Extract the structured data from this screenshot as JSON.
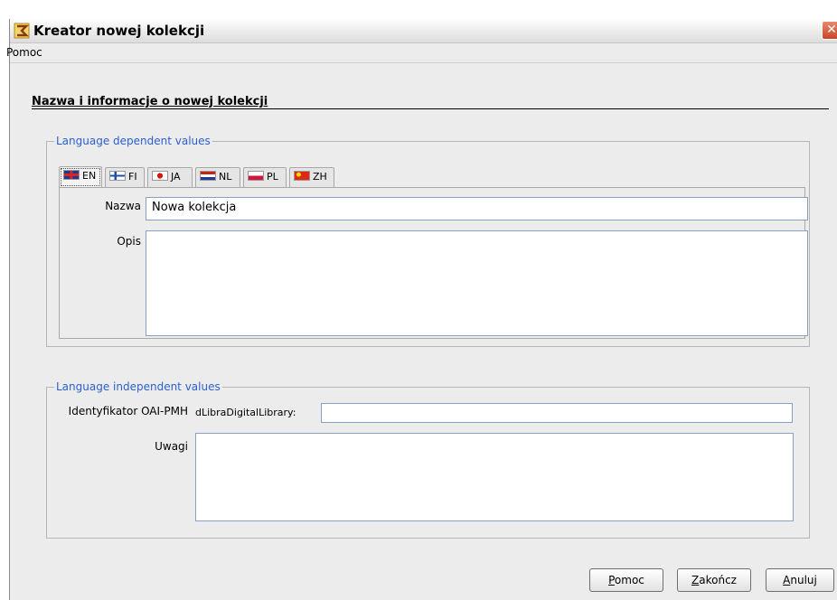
{
  "window": {
    "title": "Kreator nowej kolekcji"
  },
  "menu": {
    "items": [
      "Pomoc"
    ]
  },
  "section": {
    "title": "Nazwa i informacje o nowej kolekcji"
  },
  "lang_dependent": {
    "legend": "Language dependent values",
    "tabs": [
      {
        "code": "EN",
        "flag": "uk-flag"
      },
      {
        "code": "FI",
        "flag": "finland-flag"
      },
      {
        "code": "JA",
        "flag": "japan-flag"
      },
      {
        "code": "NL",
        "flag": "netherlands-flag"
      },
      {
        "code": "PL",
        "flag": "poland-flag"
      },
      {
        "code": "ZH",
        "flag": "china-flag"
      }
    ],
    "active_tab": "EN",
    "name_label": "Nazwa",
    "name_value": "Nowa kolekcja",
    "desc_label": "Opis",
    "desc_value": ""
  },
  "lang_independent": {
    "legend": "Language independent values",
    "oai_label": "Identyfikator OAI-PMH",
    "oai_prefix": "dLibraDigitalLibrary:",
    "oai_value": "",
    "notes_label": "Uwagi",
    "notes_value": ""
  },
  "buttons": {
    "help": {
      "accel": "P",
      "rest": "omoc"
    },
    "finish": {
      "accel": "Z",
      "rest": "akończ"
    },
    "cancel": {
      "accel": "A",
      "rest": "nuluj"
    }
  },
  "colors": {
    "legend": "#2b5fd1",
    "close": "#c8452a"
  }
}
